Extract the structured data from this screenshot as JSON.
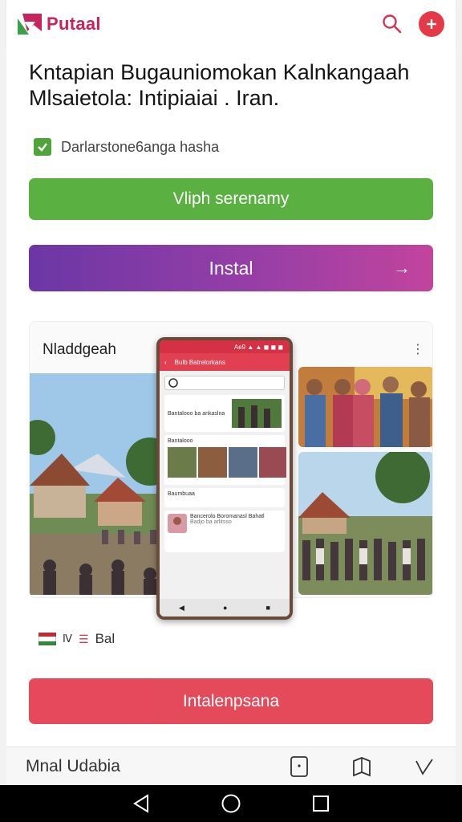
{
  "header": {
    "brand": "Putaal",
    "search_icon": "search-icon",
    "plus_icon": "plus-icon",
    "accent": "#e53947",
    "brand_color": "#c9235d"
  },
  "main": {
    "headline_line1": "Kntapian Bugauniomokan Kalnkangaah",
    "headline_line2": "Mlsaietola: Intipiaiai  . Iran.",
    "checkbox_label": "Darlarstone6anga hasha",
    "checkbox_checked": true,
    "green_button": "Vliph serenamy",
    "purple_button": "Instal",
    "gallery_title": "Nladdgeah",
    "flag_label": "Bal",
    "red_button": "Intalenpsana"
  },
  "phone": {
    "app_title": "Bulb Batrelorkans",
    "status": "Ae9 ▲ ▲ ◼ ◼ ◼",
    "card1": "Bantalooo ba ankaslna",
    "card2": "Bantalooo",
    "card3": "Baumbuaa",
    "card4": "Bancerolo Boromanasl Bahatl",
    "card4b": "Badjo ba arlitsso"
  },
  "bottom_bar": {
    "label": "Mnal Udabia"
  },
  "colors": {
    "green": "#5bb042",
    "purple": "#7b3aa6",
    "red": "#e5495b"
  }
}
